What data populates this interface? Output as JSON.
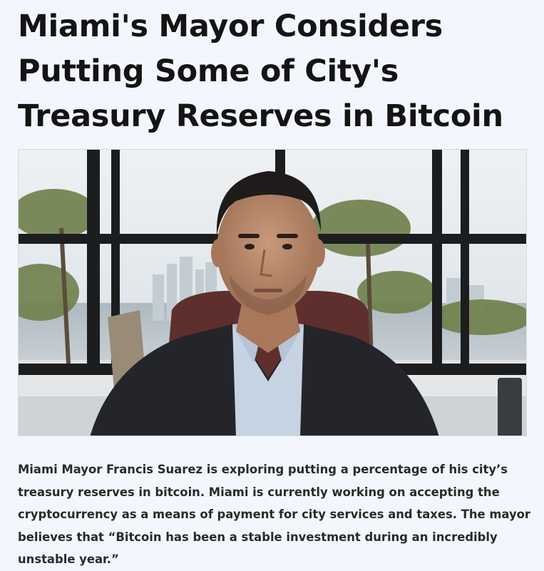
{
  "article": {
    "headline": "Miami's Mayor Considers Putting Some of City's Treasury Reserves in Bitcoin",
    "body": "Miami Mayor Francis Suarez is exploring putting a percentage of his city’s treasury reserves in bitcoin. Miami is currently working on accepting the cryptocurrency as a means of payment for city services and taxes. The mayor believes that “Bitcoin has been a stable investment during an incredibly unstable year.”"
  },
  "colors": {
    "page_background": "#f3f7fd",
    "headline": "#141414",
    "body_text": "#2a2a2a"
  }
}
